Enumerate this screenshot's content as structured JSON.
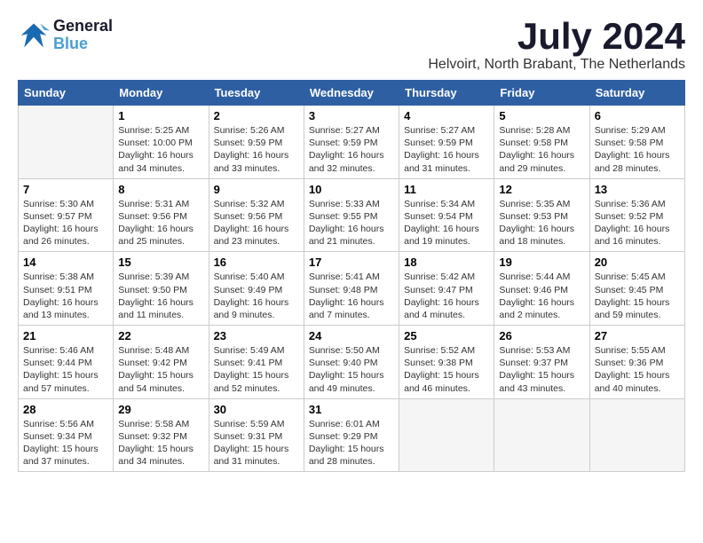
{
  "header": {
    "logo_line1": "General",
    "logo_line2": "Blue",
    "month_year": "July 2024",
    "location": "Helvoirt, North Brabant, The Netherlands"
  },
  "weekdays": [
    "Sunday",
    "Monday",
    "Tuesday",
    "Wednesday",
    "Thursday",
    "Friday",
    "Saturday"
  ],
  "weeks": [
    [
      {
        "day": "",
        "detail": ""
      },
      {
        "day": "1",
        "detail": "Sunrise: 5:25 AM\nSunset: 10:00 PM\nDaylight: 16 hours\nand 34 minutes."
      },
      {
        "day": "2",
        "detail": "Sunrise: 5:26 AM\nSunset: 9:59 PM\nDaylight: 16 hours\nand 33 minutes."
      },
      {
        "day": "3",
        "detail": "Sunrise: 5:27 AM\nSunset: 9:59 PM\nDaylight: 16 hours\nand 32 minutes."
      },
      {
        "day": "4",
        "detail": "Sunrise: 5:27 AM\nSunset: 9:59 PM\nDaylight: 16 hours\nand 31 minutes."
      },
      {
        "day": "5",
        "detail": "Sunrise: 5:28 AM\nSunset: 9:58 PM\nDaylight: 16 hours\nand 29 minutes."
      },
      {
        "day": "6",
        "detail": "Sunrise: 5:29 AM\nSunset: 9:58 PM\nDaylight: 16 hours\nand 28 minutes."
      }
    ],
    [
      {
        "day": "7",
        "detail": "Sunrise: 5:30 AM\nSunset: 9:57 PM\nDaylight: 16 hours\nand 26 minutes."
      },
      {
        "day": "8",
        "detail": "Sunrise: 5:31 AM\nSunset: 9:56 PM\nDaylight: 16 hours\nand 25 minutes."
      },
      {
        "day": "9",
        "detail": "Sunrise: 5:32 AM\nSunset: 9:56 PM\nDaylight: 16 hours\nand 23 minutes."
      },
      {
        "day": "10",
        "detail": "Sunrise: 5:33 AM\nSunset: 9:55 PM\nDaylight: 16 hours\nand 21 minutes."
      },
      {
        "day": "11",
        "detail": "Sunrise: 5:34 AM\nSunset: 9:54 PM\nDaylight: 16 hours\nand 19 minutes."
      },
      {
        "day": "12",
        "detail": "Sunrise: 5:35 AM\nSunset: 9:53 PM\nDaylight: 16 hours\nand 18 minutes."
      },
      {
        "day": "13",
        "detail": "Sunrise: 5:36 AM\nSunset: 9:52 PM\nDaylight: 16 hours\nand 16 minutes."
      }
    ],
    [
      {
        "day": "14",
        "detail": "Sunrise: 5:38 AM\nSunset: 9:51 PM\nDaylight: 16 hours\nand 13 minutes."
      },
      {
        "day": "15",
        "detail": "Sunrise: 5:39 AM\nSunset: 9:50 PM\nDaylight: 16 hours\nand 11 minutes."
      },
      {
        "day": "16",
        "detail": "Sunrise: 5:40 AM\nSunset: 9:49 PM\nDaylight: 16 hours\nand 9 minutes."
      },
      {
        "day": "17",
        "detail": "Sunrise: 5:41 AM\nSunset: 9:48 PM\nDaylight: 16 hours\nand 7 minutes."
      },
      {
        "day": "18",
        "detail": "Sunrise: 5:42 AM\nSunset: 9:47 PM\nDaylight: 16 hours\nand 4 minutes."
      },
      {
        "day": "19",
        "detail": "Sunrise: 5:44 AM\nSunset: 9:46 PM\nDaylight: 16 hours\nand 2 minutes."
      },
      {
        "day": "20",
        "detail": "Sunrise: 5:45 AM\nSunset: 9:45 PM\nDaylight: 15 hours\nand 59 minutes."
      }
    ],
    [
      {
        "day": "21",
        "detail": "Sunrise: 5:46 AM\nSunset: 9:44 PM\nDaylight: 15 hours\nand 57 minutes."
      },
      {
        "day": "22",
        "detail": "Sunrise: 5:48 AM\nSunset: 9:42 PM\nDaylight: 15 hours\nand 54 minutes."
      },
      {
        "day": "23",
        "detail": "Sunrise: 5:49 AM\nSunset: 9:41 PM\nDaylight: 15 hours\nand 52 minutes."
      },
      {
        "day": "24",
        "detail": "Sunrise: 5:50 AM\nSunset: 9:40 PM\nDaylight: 15 hours\nand 49 minutes."
      },
      {
        "day": "25",
        "detail": "Sunrise: 5:52 AM\nSunset: 9:38 PM\nDaylight: 15 hours\nand 46 minutes."
      },
      {
        "day": "26",
        "detail": "Sunrise: 5:53 AM\nSunset: 9:37 PM\nDaylight: 15 hours\nand 43 minutes."
      },
      {
        "day": "27",
        "detail": "Sunrise: 5:55 AM\nSunset: 9:36 PM\nDaylight: 15 hours\nand 40 minutes."
      }
    ],
    [
      {
        "day": "28",
        "detail": "Sunrise: 5:56 AM\nSunset: 9:34 PM\nDaylight: 15 hours\nand 37 minutes."
      },
      {
        "day": "29",
        "detail": "Sunrise: 5:58 AM\nSunset: 9:32 PM\nDaylight: 15 hours\nand 34 minutes."
      },
      {
        "day": "30",
        "detail": "Sunrise: 5:59 AM\nSunset: 9:31 PM\nDaylight: 15 hours\nand 31 minutes."
      },
      {
        "day": "31",
        "detail": "Sunrise: 6:01 AM\nSunset: 9:29 PM\nDaylight: 15 hours\nand 28 minutes."
      },
      {
        "day": "",
        "detail": ""
      },
      {
        "day": "",
        "detail": ""
      },
      {
        "day": "",
        "detail": ""
      }
    ]
  ]
}
